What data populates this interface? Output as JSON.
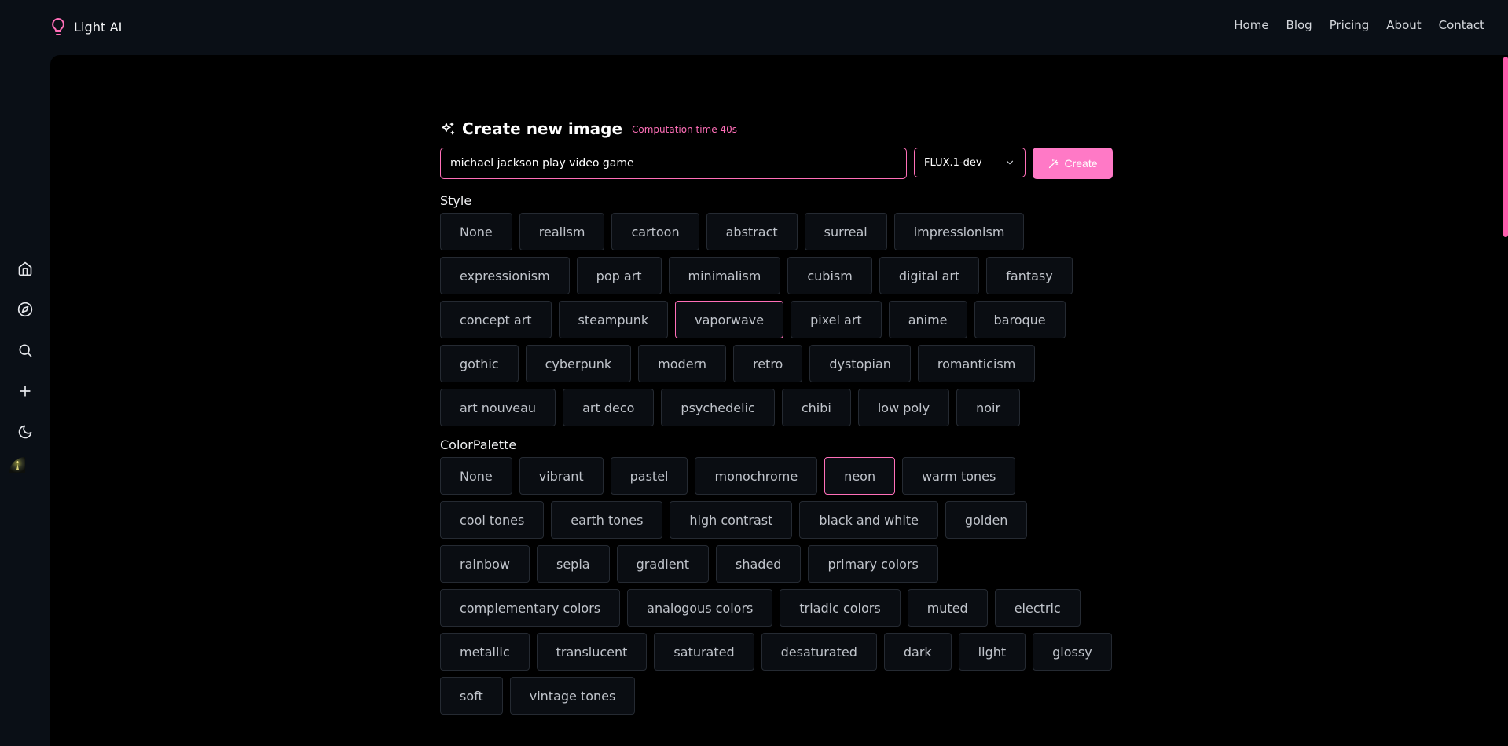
{
  "brand": {
    "name": "Light AI",
    "icon": "lightbulb-icon"
  },
  "nav": [
    {
      "label": "Home"
    },
    {
      "label": "Blog"
    },
    {
      "label": "Pricing"
    },
    {
      "label": "About"
    },
    {
      "label": "Contact"
    }
  ],
  "rail": [
    {
      "icon": "home-icon"
    },
    {
      "icon": "compass-icon"
    },
    {
      "icon": "search-icon"
    },
    {
      "icon": "plus-icon"
    },
    {
      "icon": "moon-icon"
    },
    {
      "icon": "avatar"
    }
  ],
  "create": {
    "title": "Create new image",
    "computation_time": "Computation time 40s",
    "prompt_value": "michael jackson play video game",
    "model": "FLUX.1-dev",
    "button_label": "Create"
  },
  "style": {
    "label": "Style",
    "selected": "vaporwave",
    "options": [
      "None",
      "realism",
      "cartoon",
      "abstract",
      "surreal",
      "impressionism",
      "expressionism",
      "pop art",
      "minimalism",
      "cubism",
      "digital art",
      "fantasy",
      "concept art",
      "steampunk",
      "vaporwave",
      "pixel art",
      "anime",
      "baroque",
      "gothic",
      "cyberpunk",
      "modern",
      "retro",
      "dystopian",
      "romanticism",
      "art nouveau",
      "art deco",
      "psychedelic",
      "chibi",
      "low poly",
      "noir"
    ]
  },
  "palette": {
    "label": "ColorPalette",
    "selected": "neon",
    "options": [
      "None",
      "vibrant",
      "pastel",
      "monochrome",
      "neon",
      "warm tones",
      "cool tones",
      "earth tones",
      "high contrast",
      "black and white",
      "golden",
      "rainbow",
      "sepia",
      "gradient",
      "shaded",
      "primary colors",
      "complementary colors",
      "analogous colors",
      "triadic colors",
      "muted",
      "electric",
      "metallic",
      "translucent",
      "saturated",
      "desaturated",
      "dark",
      "light",
      "glossy",
      "soft",
      "vintage tones"
    ]
  },
  "colors": {
    "accent": "#ff6fb8",
    "button": "#ff79c6",
    "background": "#0a0f16",
    "panel": "#000000"
  }
}
